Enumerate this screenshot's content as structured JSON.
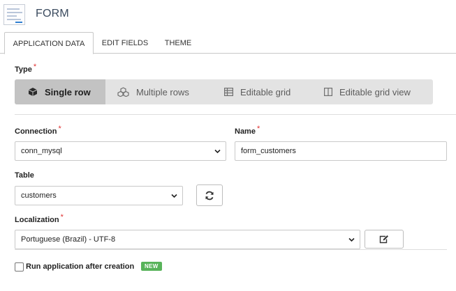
{
  "header": {
    "title": "FORM",
    "icon": "form-document-icon"
  },
  "tabs": [
    {
      "label": "APPLICATION DATA",
      "active": true
    },
    {
      "label": "EDIT FIELDS",
      "active": false
    },
    {
      "label": "THEME",
      "active": false
    }
  ],
  "type_field": {
    "label": "Type",
    "required_mark": "*",
    "options": [
      {
        "label": "Single row",
        "icon": "cube-icon",
        "selected": true
      },
      {
        "label": "Multiple rows",
        "icon": "cubes-icon",
        "selected": false
      },
      {
        "label": "Editable grid",
        "icon": "table-icon",
        "selected": false
      },
      {
        "label": "Editable grid view",
        "icon": "columns-icon",
        "selected": false
      }
    ]
  },
  "connection": {
    "label": "Connection",
    "required_mark": "*",
    "value": "conn_mysql"
  },
  "name": {
    "label": "Name",
    "required_mark": "*",
    "value": "form_customers"
  },
  "table": {
    "label": "Table",
    "value": "customers",
    "refresh_icon": "refresh-icon"
  },
  "localization": {
    "label": "Localization",
    "required_mark": "*",
    "value": "Portuguese (Brazil) - UTF-8",
    "edit_icon": "edit-icon"
  },
  "run_after": {
    "label": "Run application after creation",
    "checked": false,
    "badge": "NEW"
  },
  "colors": {
    "badge": "#58b35a",
    "required": "#e03030",
    "active_segment": "#c3c3c3",
    "segment_bg": "#e3e3e3"
  }
}
